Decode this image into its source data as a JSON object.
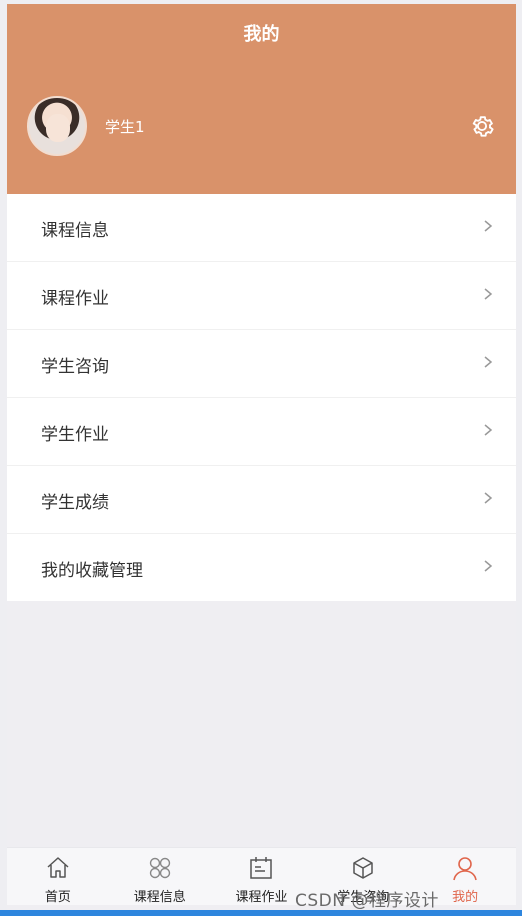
{
  "header": {
    "title": "我的",
    "username": "学生1",
    "bg_color": "#d9926a"
  },
  "menu": {
    "items": [
      {
        "label": "课程信息"
      },
      {
        "label": "课程作业"
      },
      {
        "label": "学生咨询"
      },
      {
        "label": "学生作业"
      },
      {
        "label": "学生成绩"
      },
      {
        "label": "我的收藏管理"
      }
    ]
  },
  "tabbar": {
    "items": [
      {
        "label": "首页",
        "icon": "home-icon"
      },
      {
        "label": "课程信息",
        "icon": "grid-icon"
      },
      {
        "label": "课程作业",
        "icon": "calendar-icon"
      },
      {
        "label": "学生咨询",
        "icon": "box-icon"
      },
      {
        "label": "我的",
        "icon": "user-icon",
        "active": true
      }
    ],
    "active_color": "#e0664c"
  },
  "watermark": "CSDN @程序设计"
}
